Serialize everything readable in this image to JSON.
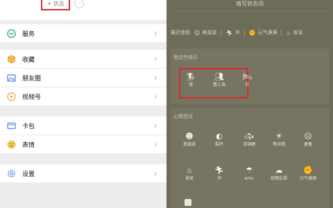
{
  "left_panel": {
    "status_button": {
      "plus": "+",
      "label": "状态"
    },
    "more_button": "…",
    "menu": [
      {
        "label": "服务",
        "icon": "service-icon",
        "color": "#2aae67"
      },
      {
        "label": "收藏",
        "icon": "favorites-cube-icon",
        "color": "#f0a54a"
      },
      {
        "label": "朋友圈",
        "icon": "moments-image-icon",
        "color": "#4a7fe0"
      },
      {
        "label": "视频号",
        "icon": "channels-icon",
        "color": "#f0a54a"
      },
      {
        "label": "卡包",
        "icon": "card-wallet-icon",
        "color": "#4a90e2"
      },
      {
        "label": "表情",
        "icon": "emoji-face-icon",
        "color": "#f2c94c"
      },
      {
        "label": "设置",
        "icon": "settings-gear-icon",
        "color": "#4a90e2"
      }
    ]
  },
  "right_panel": {
    "title": "填写状态词",
    "recent_label": "最近使用",
    "recent": [
      {
        "label": "美滋滋",
        "icon": "smile-icon"
      },
      {
        "label": "冲",
        "icon": "runner-icon"
      },
      {
        "label": "元气满满",
        "icon": "energy-icon"
      },
      {
        "label": "发呆",
        "icon": "daze-icon"
      }
    ],
    "holiday": {
      "title": "劳动节快乐",
      "items": [
        {
          "label": "浪",
          "icon": "wave-runner-icon"
        },
        {
          "label": "看人海",
          "icon": "crowd-icon"
        },
        {
          "label": "宅",
          "icon": "home-bed-icon"
        }
      ]
    },
    "mood": {
      "title": "心情想法",
      "items": [
        {
          "label": "美滋滋",
          "icon": "smile-icon"
        },
        {
          "label": "裂开",
          "icon": "cracked-icon"
        },
        {
          "label": "求锦鲤",
          "icon": "koi-icon"
        },
        {
          "label": "等天晴",
          "icon": "sun-icon"
        },
        {
          "label": "疲惫",
          "icon": "tired-icon"
        },
        {
          "label": "发呆",
          "icon": "daze-icon"
        },
        {
          "label": "冲",
          "icon": "runner-icon"
        },
        {
          "label": "emo",
          "icon": "emo-icon"
        },
        {
          "label": "胡思乱想",
          "icon": "thought-cloud-icon"
        },
        {
          "label": "元气满满",
          "icon": "energy-icon"
        }
      ]
    },
    "bottom_partial_icon": "robot-icon"
  }
}
